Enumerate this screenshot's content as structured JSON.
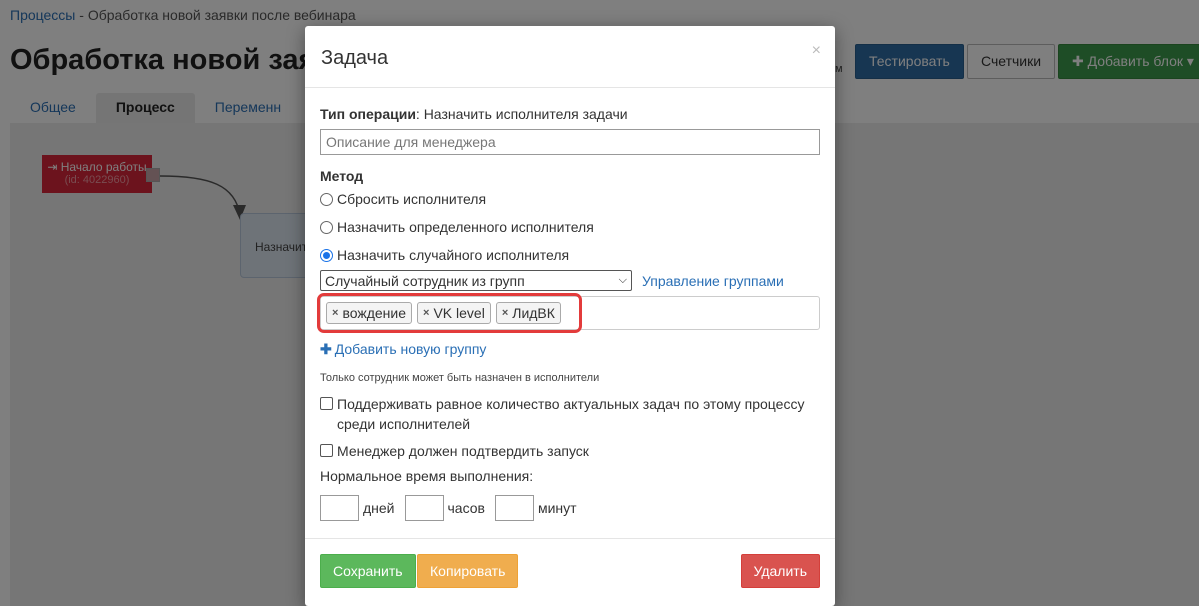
{
  "background": {
    "breadcrumb": {
      "parent": "Процессы",
      "separator": " - ",
      "current": "Обработка новой заявки после вебинара"
    },
    "page_title": "Обработка новой заяв",
    "tabs": [
      {
        "label": "Общее"
      },
      {
        "label": "Процесс"
      },
      {
        "label": "Переменн"
      }
    ],
    "side_text": "м",
    "buttons": {
      "test": "Тестировать",
      "counters": "Счетчики",
      "add_block": "✚ Добавить блок ▾"
    },
    "start_node": {
      "title": "⇥ Начало работы",
      "subtitle": "(id: 4022960)"
    },
    "task_node": {
      "text": "Назначит"
    }
  },
  "modal": {
    "title": "Задача",
    "close": "×",
    "operation_type_label": "Тип операции",
    "operation_type_value": ": Назначить исполнителя задачи",
    "description_placeholder": "Описание для менеджера",
    "method_label": "Метод",
    "methods": [
      {
        "label": "Сбросить исполнителя",
        "checked": false
      },
      {
        "label": "Назначить определенного исполнителя",
        "checked": false
      },
      {
        "label": "Назначить случайного исполнителя",
        "checked": true
      }
    ],
    "select_value": "Случайный сотрудник из групп",
    "manage_groups_link": "Управление группами",
    "tags": [
      "вождение",
      "VK level",
      "ЛидВК"
    ],
    "tag_remove": "×",
    "add_group": "Добавить новую группу",
    "add_group_plus": "✚",
    "hint": "Только сотрудник может быть назначен в исполнители",
    "checkbox_balance": "Поддерживать равное количество актуальных задач по этому процессу среди исполнителей",
    "checkbox_confirm": "Менеджер должен подтвердить запуск",
    "normal_time_label": "Нормальное время выполнения:",
    "time_units": {
      "days": "дней",
      "hours": "часов",
      "minutes": "минут"
    },
    "footer": {
      "save": "Сохранить",
      "copy": "Копировать",
      "delete": "Удалить"
    },
    "highlight_color": "#e33b3b"
  }
}
